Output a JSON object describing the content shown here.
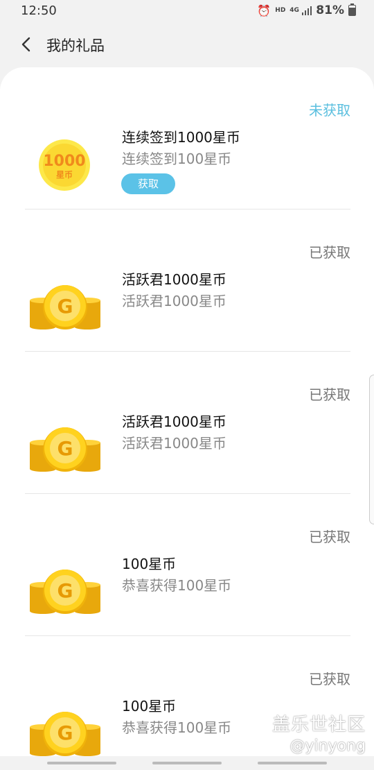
{
  "statusbar": {
    "time": "12:50",
    "hd": "HD",
    "net": "4G",
    "battery": "81%",
    "battery_level": 0.81
  },
  "header": {
    "title": "我的礼品"
  },
  "medal_text": {
    "amount": "1000",
    "unit": "星币"
  },
  "coin_letter": "G",
  "items": [
    {
      "status": "未获取",
      "name": "连续签到1000星币",
      "desc": "连续签到100星币",
      "button": "获取"
    },
    {
      "status": "已获取",
      "name": "活跃君1000星币",
      "desc": "活跃君1000星币"
    },
    {
      "status": "已获取",
      "name": "活跃君1000星币",
      "desc": "活跃君1000星币"
    },
    {
      "status": "已获取",
      "name": "100星币",
      "desc": "恭喜获得100星币"
    },
    {
      "status": "已获取",
      "name": "100星币",
      "desc": "恭喜获得100星币"
    }
  ],
  "watermark": {
    "line1": "盖乐世社区",
    "line2": "@yinyong"
  }
}
